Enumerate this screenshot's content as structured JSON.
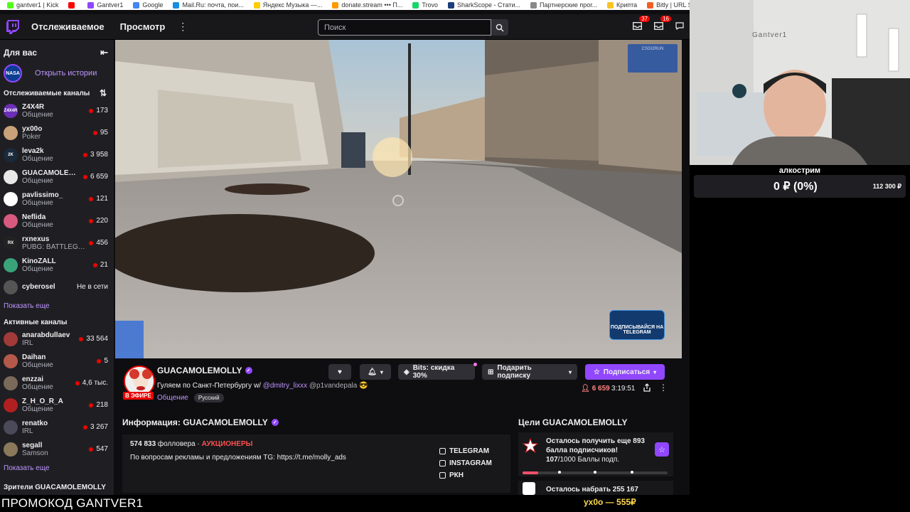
{
  "bookmarks": [
    {
      "label": "gantver1 | Kick",
      "color": "#53fc18"
    },
    {
      "label": "",
      "color": "#ff0000"
    },
    {
      "label": "Gantver1",
      "color": "#9147ff"
    },
    {
      "label": "Google",
      "color": "#4285f4"
    },
    {
      "label": "Mail.Ru: почта, пои...",
      "color": "#168de2"
    },
    {
      "label": "Яндекс Музыка —...",
      "color": "#ffcc00"
    },
    {
      "label": "donate.stream ••• П...",
      "color": "#ff9900"
    },
    {
      "label": "Trovo",
      "color": "#19d66b"
    },
    {
      "label": "SharkScope - Стати...",
      "color": "#1c3d7a"
    },
    {
      "label": "Партнерские прог...",
      "color": "#888888"
    },
    {
      "label": "Крипта",
      "color": "#f7c325"
    },
    {
      "label": "Bitly | URL Shortene...",
      "color": "#ee6123"
    }
  ],
  "nav": {
    "following": "Отслеживаемое",
    "browse": "Просмотр",
    "search_placeholder": "Поиск",
    "badge1": "37",
    "badge2": "16"
  },
  "sidebar": {
    "for_you": "Для вас",
    "open_stories": "Открыть истории",
    "followed_title": "Отслеживаемые каналы",
    "followed": [
      {
        "name": "Z4X4R",
        "cat": "Общение",
        "viewers": "173",
        "live": true,
        "color": "#6b2fb5",
        "initials": "Z4X4R"
      },
      {
        "name": "yx00o",
        "cat": "Poker",
        "viewers": "95",
        "live": true,
        "color": "#c9a27a",
        "initials": ""
      },
      {
        "name": "leva2k",
        "cat": "Общение",
        "viewers": "3 958",
        "live": true,
        "color": "#1a2a3a",
        "initials": "2K"
      },
      {
        "name": "GUACAMOLEM...",
        "cat": "Общение",
        "viewers": "6 659",
        "live": true,
        "color": "#e8e8e8",
        "initials": ""
      },
      {
        "name": "pavlissimo_",
        "cat": "Общение",
        "viewers": "121",
        "live": true,
        "color": "#ffffff",
        "initials": ""
      },
      {
        "name": "Neflida",
        "cat": "Общение",
        "viewers": "220",
        "live": true,
        "color": "#d85a7f",
        "initials": ""
      },
      {
        "name": "rxnexus",
        "cat": "PUBG: BATTLEGR...",
        "viewers": "456",
        "live": true,
        "color": "#222222",
        "initials": "RX"
      },
      {
        "name": "KinoZALL",
        "cat": "Общение",
        "viewers": "21",
        "live": true,
        "color": "#3aa37a",
        "initials": ""
      },
      {
        "name": "cyberosel",
        "cat": "",
        "viewers": "Не в сети",
        "live": false,
        "color": "#555555",
        "initials": ""
      }
    ],
    "show_more": "Показать еще",
    "active_title": "Активные каналы",
    "active": [
      {
        "name": "anarabdullaev",
        "cat": "IRL",
        "viewers": "33 564",
        "color": "#a33a3a"
      },
      {
        "name": "Daihan",
        "cat": "Общение",
        "viewers": "5",
        "color": "#b55a4a"
      },
      {
        "name": "enzzai",
        "cat": "Общение",
        "viewers": "4,6 тыс.",
        "color": "#7a6a5a"
      },
      {
        "name": "Z_H_O_R_A",
        "cat": "Общение",
        "viewers": "218",
        "color": "#b02020"
      },
      {
        "name": "renatko",
        "cat": "IRL",
        "viewers": "3 267",
        "color": "#4a4a5a"
      },
      {
        "name": "segall",
        "cat": "Samson",
        "viewers": "547",
        "color": "#8a7a5a"
      }
    ],
    "show_more2": "Показать еще",
    "viewers_title": "Зрители GUACAMOLEMOLLY"
  },
  "video": {
    "tg_badge": "ПОДПИСЫВАЙСЯ НА TELEGRAM",
    "corner_badge": "CSGORUN"
  },
  "stream": {
    "live_label": "В ЭФИРЕ",
    "name": "GUACAMOLEMOLLY",
    "title_main": "Гуляем по Санкт-Петербургу w/ ",
    "mention1": "@dmitry_lixxx",
    "mention2": " @p1vandepala 😎",
    "category": "Общение",
    "tag": "Русский",
    "bits_label": "Bits: скидка 30%",
    "gift_label": "Подарить подписку",
    "subscribe_label": "Подписаться",
    "viewers": "6 659",
    "uptime": "3:19:51"
  },
  "about": {
    "title": "Информация: GUACAMOLEMOLLY",
    "followers": "574 833",
    "followers_label": " фолловера · ",
    "team": "АУКЦИОНЕРЫ",
    "ad_text": "По вопросам рекламы и предложениям TG: https://t.me/molly_ads",
    "socials": [
      "TELEGRAM",
      "INSTAGRAM",
      "РКН"
    ]
  },
  "goals": {
    "title": "Цели GUACAMOLEMOLLY",
    "goal1_text": "Осталось получить еще 893 балла подписчиков!",
    "goal1_progress": "107",
    "goal1_total": "/1000 Баллы подп.",
    "goal1_fraction": 0.107,
    "goal2_text": "Осталось набрать 255 167"
  },
  "webcam": {
    "wall_text": "Gantver1",
    "alert_title": "алкострим",
    "amount": "0 ₽ (0%)",
    "goal": "112 300 ₽"
  },
  "ticker": {
    "promo": "ПРОМОКОД GANTVER1",
    "donation": "yx0o — 555₽"
  }
}
